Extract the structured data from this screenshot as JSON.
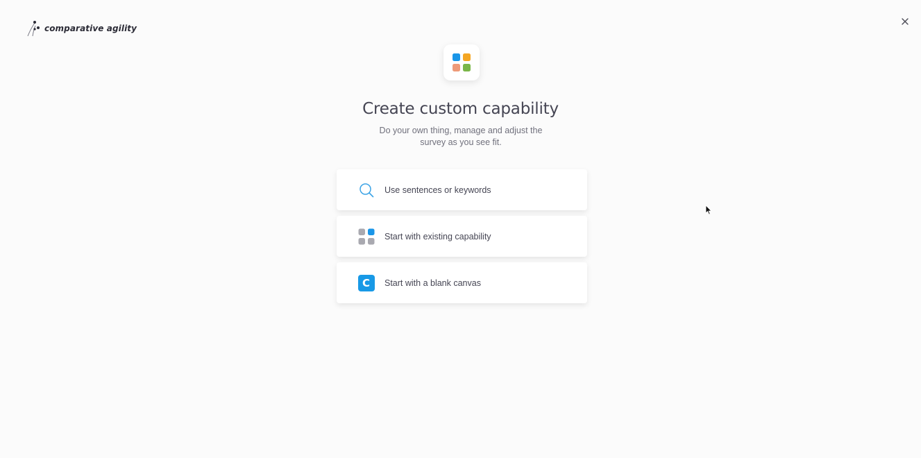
{
  "brand": {
    "name": "comparative agility",
    "logo_icon": "comparative-agility-logo"
  },
  "header": {
    "close_icon": "close-icon"
  },
  "main": {
    "hero_icon": "grid-apps-icon",
    "title": "Create custom capability",
    "subtitle": "Do your own thing, manage and adjust the survey as you see fit."
  },
  "options": [
    {
      "icon": "search-icon",
      "label": "Use sentences or keywords"
    },
    {
      "icon": "grid-apps-icon",
      "label": "Start with existing capability"
    },
    {
      "icon": "letter-c-icon",
      "icon_text": "C",
      "label": "Start with a blank canvas"
    }
  ],
  "colors": {
    "accent_blue": "#1899e6",
    "tile_blue": "#1a96e8",
    "tile_orange": "#f4a623",
    "tile_salmon": "#ee9a78",
    "tile_green": "#7ab648",
    "tile_grey": "#a9a9b0",
    "search_icon": "#3ba3e6"
  }
}
